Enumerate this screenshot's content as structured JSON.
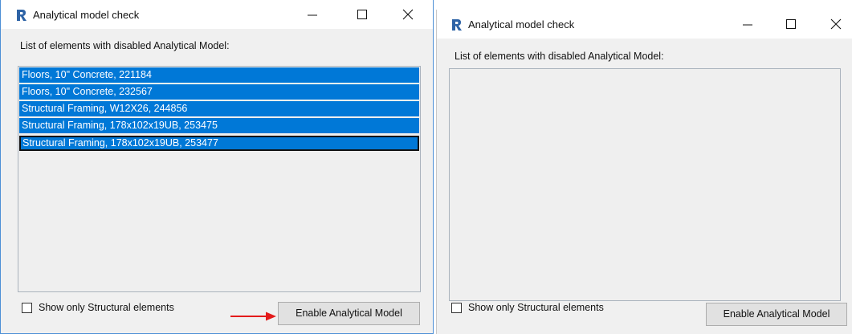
{
  "left_window": {
    "title": "Analytical model check",
    "list_label": "List of elements with disabled Analytical Model:",
    "items": [
      {
        "label": "Floors, 10\" Concrete, 221184"
      },
      {
        "label": "Floors, 10\" Concrete, 232567"
      },
      {
        "label": "Structural Framing, W12X26, 244856"
      },
      {
        "label": "Structural Framing, 178x102x19UB, 253475"
      },
      {
        "label": "Structural Framing, 178x102x19UB, 253477"
      }
    ],
    "checkbox_label": "Show only Structural elements",
    "button_label": "Enable Analytical Model"
  },
  "right_window": {
    "title": "Analytical model check",
    "list_label": "List of elements with disabled Analytical Model:",
    "items": [],
    "checkbox_label": "Show only Structural elements",
    "button_label": "Enable Analytical Model"
  },
  "colors": {
    "selection": "#0078d7",
    "annotation_arrow": "#e31b1b",
    "app_icon": "#2e63a6"
  },
  "icons": [
    "revit-icon",
    "minimize-icon",
    "maximize-icon",
    "close-icon",
    "red-arrow-icon"
  ]
}
